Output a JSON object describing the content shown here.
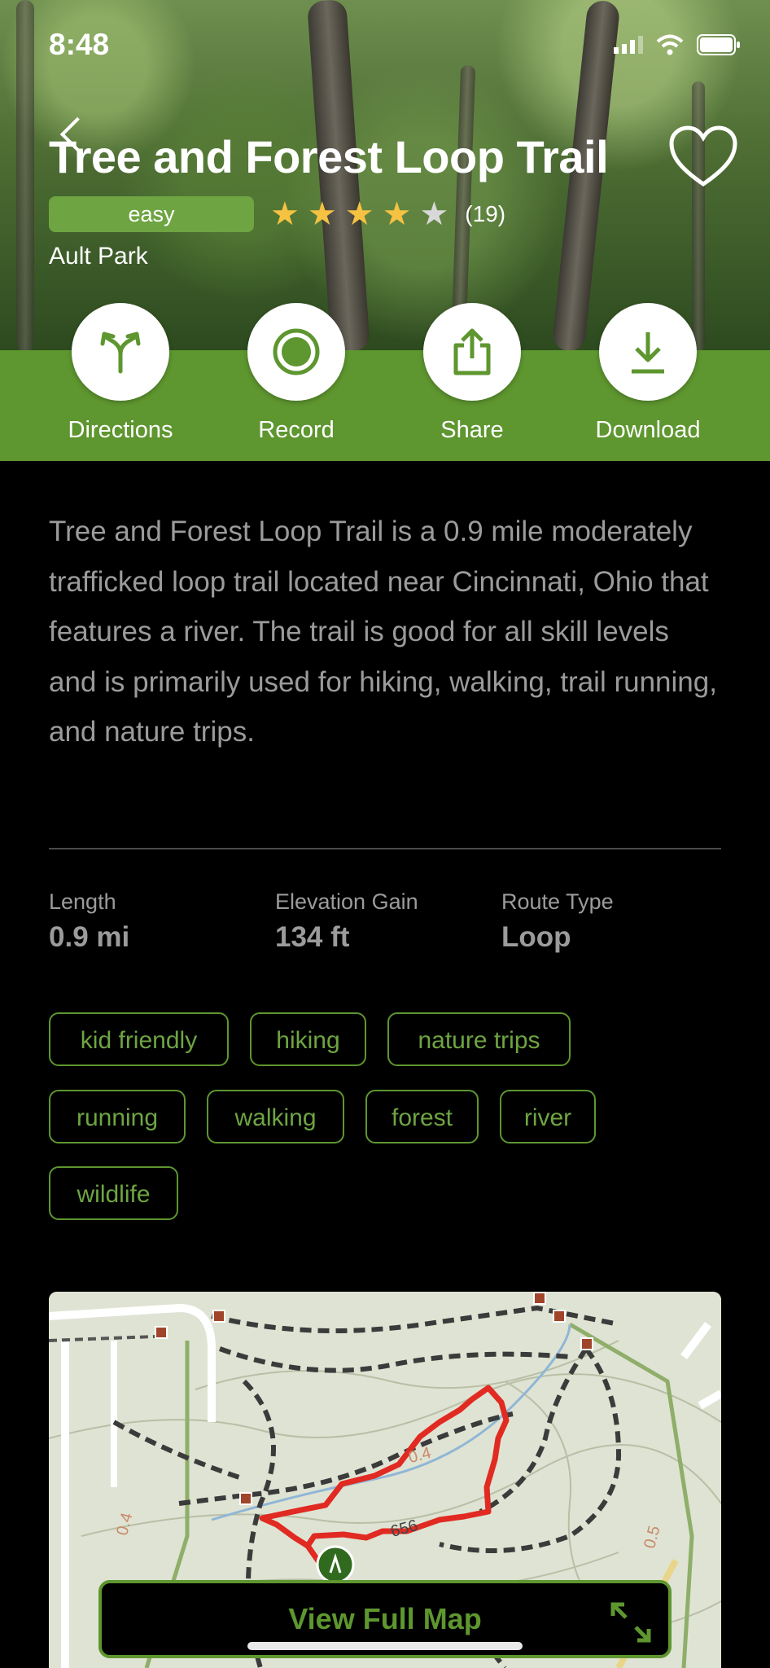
{
  "status": {
    "time": "8:48"
  },
  "trail": {
    "title": "Tree and Forest Loop Trail",
    "difficulty": "easy",
    "rating": 4,
    "rating_max": 5,
    "review_count": "(19)",
    "park": "Ault Park",
    "description": "Tree and Forest Loop Trail  is a 0.9 mile moderately trafficked loop trail located near Cincinnati, Ohio that features a river. The trail is good for all skill levels and is primarily used for hiking, walking, trail running, and nature trips."
  },
  "actions": [
    {
      "label": "Directions",
      "icon": "directions-icon"
    },
    {
      "label": "Record",
      "icon": "record-icon"
    },
    {
      "label": "Share",
      "icon": "share-icon"
    },
    {
      "label": "Download",
      "icon": "download-icon"
    }
  ],
  "stats": [
    {
      "label": "Length",
      "value": "0.9 mi"
    },
    {
      "label": "Elevation Gain",
      "value": "134 ft"
    },
    {
      "label": "Route Type",
      "value": "Loop"
    }
  ],
  "tags": [
    "kid friendly",
    "hiking",
    "nature trips",
    "running",
    "walking",
    "forest",
    "river",
    "wildlife"
  ],
  "map": {
    "labels": [
      "0.4",
      "656",
      "0.4",
      "0.5"
    ],
    "button_label": "View Full Map"
  },
  "colors": {
    "accent": "#5e962f",
    "star": "#f5c242",
    "route": "#e02a22"
  }
}
